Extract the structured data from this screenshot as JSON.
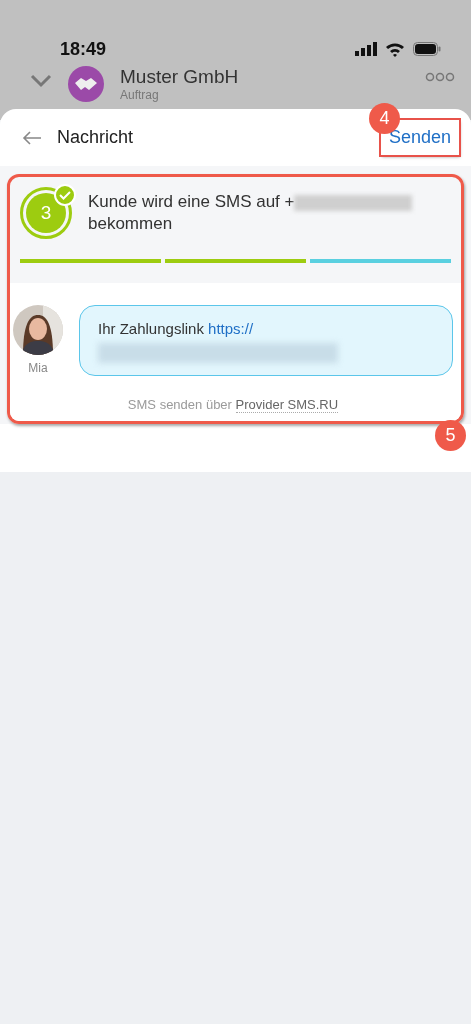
{
  "status_bar": {
    "time": "18:49"
  },
  "background_header": {
    "title": "Muster GmbH",
    "subtitle": "Auftrag"
  },
  "sheet": {
    "title": "Nachricht",
    "action": "Senden",
    "step": {
      "number": "3",
      "done": true,
      "text_before": "Kunde wird eine SMS auf +",
      "text_after": "bekommen"
    },
    "progress": [
      {
        "kind": "done"
      },
      {
        "kind": "done"
      },
      {
        "kind": "current"
      }
    ],
    "message": {
      "sender": "Mia",
      "text": "Ihr Zahlungslink",
      "link": "https://"
    },
    "footer": {
      "text": "SMS senden über",
      "provider": "Provider SMS.RU"
    }
  },
  "annotations": [
    {
      "number": "4"
    },
    {
      "number": "5"
    }
  ]
}
